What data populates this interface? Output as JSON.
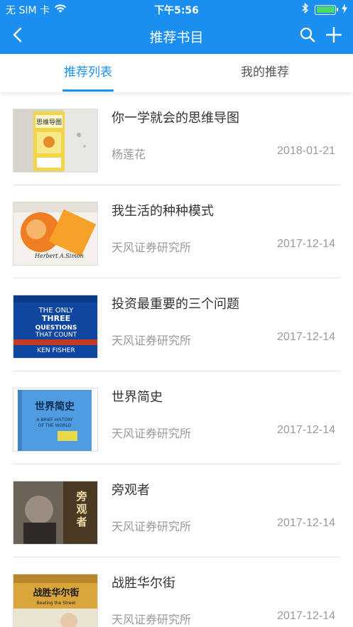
{
  "status_bar": {
    "carrier": "无 SIM 卡",
    "time": "下午5:56",
    "battery_level": 1.0
  },
  "nav": {
    "title": "推荐书目",
    "icons": [
      "chevron-left-icon",
      "search-icon",
      "plus-icon"
    ]
  },
  "tabs": [
    {
      "label": "推荐列表",
      "active": true
    },
    {
      "label": "我的推荐",
      "active": false
    }
  ],
  "books": [
    {
      "title": "你一学就会的思维导图",
      "author": "杨莲花",
      "date": "2018-01-21",
      "cover_text": "思维导图"
    },
    {
      "title": "我生活的种种模式",
      "author": "天风证券研究所",
      "date": "2017-12-14",
      "cover_text": "Herbert A.Simon"
    },
    {
      "title": "投资最重要的三个问题",
      "author": "天风证券研究所",
      "date": "2017-12-14",
      "cover_text": "THE ONLY THREE QUESTIONS THAT COUNT · KEN FISHER"
    },
    {
      "title": "世界简史",
      "author": "天风证券研究所",
      "date": "2017-12-14",
      "cover_text": "世界简史 · A BRIEF HISTORY OF THE WORLD"
    },
    {
      "title": "旁观者",
      "author": "天风证券研究所",
      "date": "2017-12-14",
      "cover_text": "旁观者"
    },
    {
      "title": "战胜华尔街",
      "author": "天风证券研究所",
      "date": "2017-12-14",
      "cover_text": "战胜华尔街 · Beating the Street"
    }
  ],
  "colors": {
    "primary": "#1a8ff0",
    "title_text": "#333333",
    "meta_text": "#9a9a9a",
    "battery": "#4cd964"
  }
}
